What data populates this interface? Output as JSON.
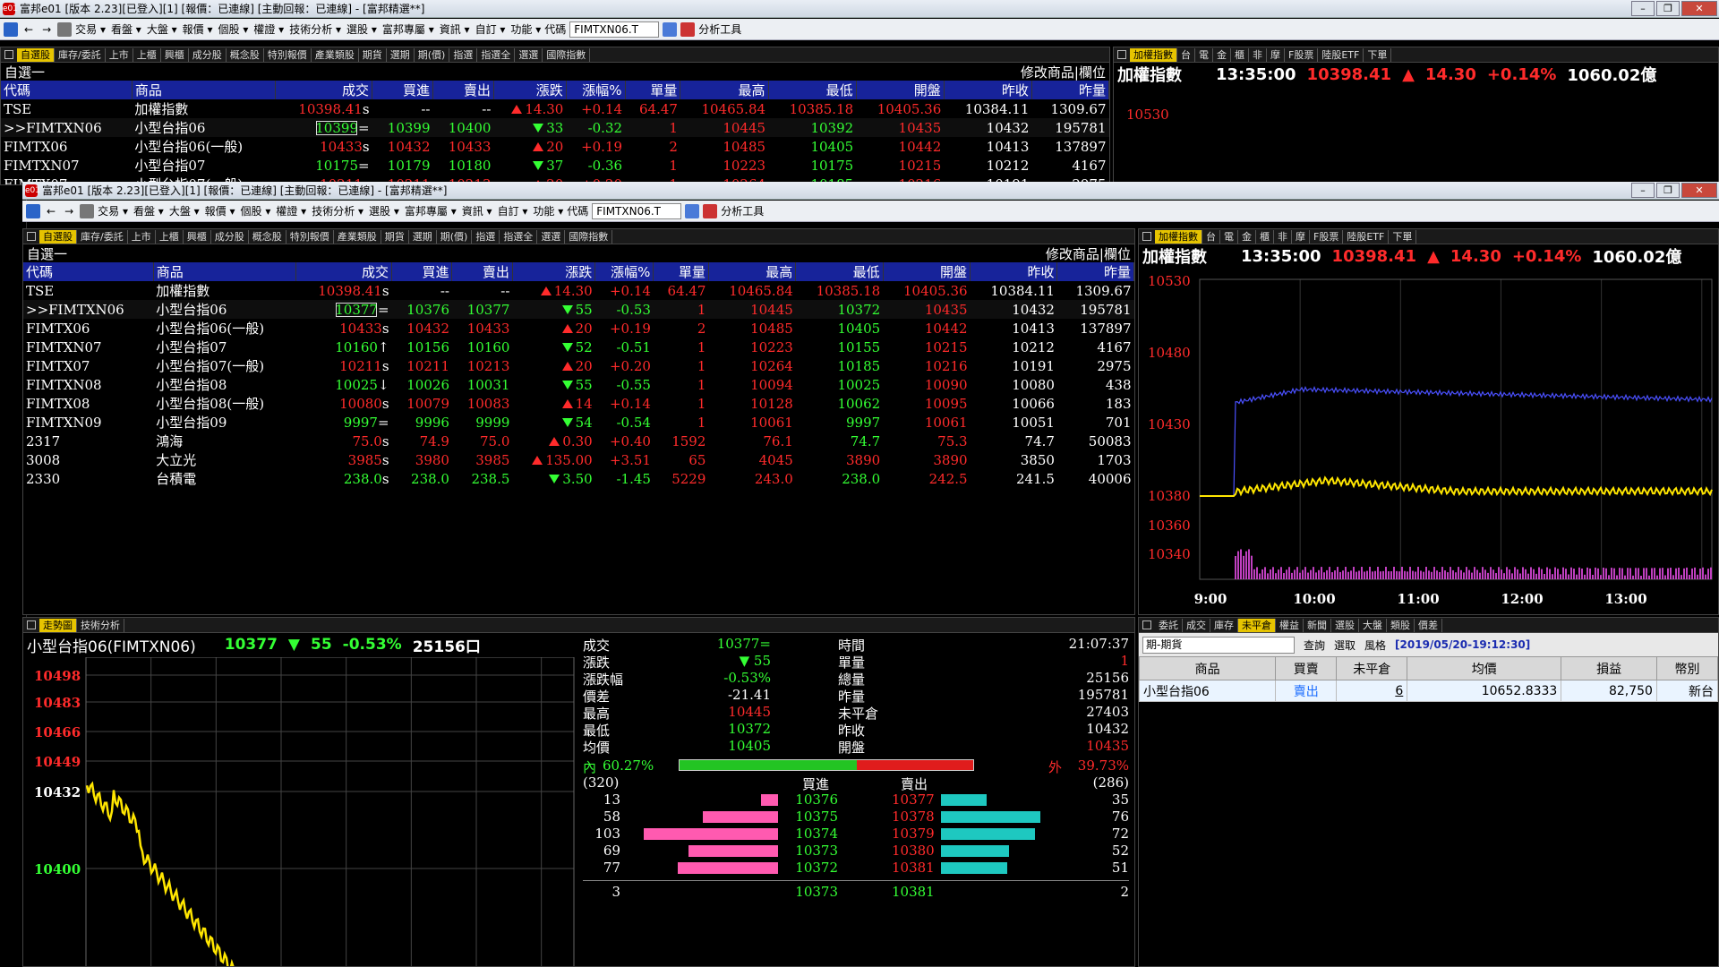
{
  "window": {
    "title_back": "富邦e01 [版本 2.23][已登入][1] [報價：已連線] [主動回報：已連線] - [富邦精選**]",
    "title_front": "富邦e01 [版本 2.23][已登入][1] [報價：已連線] [主動回報：已連線] - [富邦精選**]",
    "app_badge": "e01"
  },
  "toolbar": {
    "items": [
      "交易",
      "看盤",
      "大盤",
      "報價",
      "個股",
      "權證",
      "技術分析",
      "選股",
      "富邦專屬",
      "資訊",
      "自訂",
      "功能"
    ],
    "code_label": "代碼",
    "code_value_back": "FIMTXN06.T",
    "code_value_front": "FIMTXN06.T",
    "analysis_tools": "分析工具"
  },
  "quote_tabs": [
    "自選股",
    "庫存/委託",
    "上市",
    "上櫃",
    "興櫃",
    "成分股",
    "概念股",
    "特別報價",
    "產業類股",
    "期貨",
    "選期",
    "期(價)",
    "指選",
    "指選全",
    "選選",
    "國際指數"
  ],
  "quote_panel": {
    "list_name": "自選一",
    "modify": "修改商品",
    "columns_btn": "欄位",
    "headers": [
      "代碼",
      "商品",
      "成交",
      "買進",
      "賣出",
      "漲跌",
      "漲幅%",
      "單量",
      "最高",
      "最低",
      "開盤",
      "昨收",
      "昨量"
    ],
    "rows_back": [
      {
        "code": "TSE",
        "name": "加權指數",
        "last": "10398.41",
        "sfx": "s",
        "bid": "--",
        "ask": "--",
        "chg": "14.30",
        "dir": "up",
        "pct": "+0.14",
        "vol": "64.47",
        "high": "10465.84",
        "low": "10385.18",
        "open": "10405.36",
        "prev": "10384.11",
        "pvol": "1309.67"
      },
      {
        "code": ">>FIMTXN06",
        "name": "小型台指06",
        "last": "10399",
        "sfx": "=",
        "bid": "10399",
        "ask": "10400",
        "chg": "33",
        "dir": "down",
        "pct": "-0.32",
        "vol": "1",
        "high": "10445",
        "low": "10392",
        "open": "10435",
        "prev": "10432",
        "pvol": "195781"
      },
      {
        "code": "FIMTX06",
        "name": "小型台指06(一般)",
        "last": "10433",
        "sfx": "s",
        "bid": "10432",
        "ask": "10433",
        "chg": "20",
        "dir": "up",
        "pct": "+0.19",
        "vol": "2",
        "high": "10485",
        "low": "10405",
        "open": "10442",
        "prev": "10413",
        "pvol": "137897"
      },
      {
        "code": "FIMTXN07",
        "name": "小型台指07",
        "last": "10175",
        "sfx": "=",
        "bid": "10179",
        "ask": "10180",
        "chg": "37",
        "dir": "down",
        "pct": "-0.36",
        "vol": "1",
        "high": "10223",
        "low": "10175",
        "open": "10215",
        "prev": "10212",
        "pvol": "4167"
      },
      {
        "code": "FIMTX07",
        "name": "小型台指07(一般)",
        "last": "10211",
        "sfx": "s",
        "bid": "10211",
        "ask": "10213",
        "chg": "20",
        "dir": "up",
        "pct": "+0.20",
        "vol": "1",
        "high": "10264",
        "low": "10185",
        "open": "10216",
        "prev": "10191",
        "pvol": "2975"
      }
    ],
    "rows": [
      {
        "code": "TSE",
        "name": "加權指數",
        "last": "10398.41",
        "sfx": "s",
        "bid": "--",
        "ask": "--",
        "chg": "14.30",
        "dir": "up",
        "pct": "+0.14",
        "vol": "64.47",
        "high": "10465.84",
        "low": "10385.18",
        "open": "10405.36",
        "prev": "10384.11",
        "pvol": "1309.67"
      },
      {
        "code": ">>FIMTXN06",
        "name": "小型台指06",
        "last": "10377",
        "sfx": "=",
        "bid": "10376",
        "ask": "10377",
        "chg": "55",
        "dir": "down",
        "pct": "-0.53",
        "vol": "1",
        "high": "10445",
        "low": "10372",
        "open": "10435",
        "prev": "10432",
        "pvol": "195781"
      },
      {
        "code": "FIMTX06",
        "name": "小型台指06(一般)",
        "last": "10433",
        "sfx": "s",
        "bid": "10432",
        "ask": "10433",
        "chg": "20",
        "dir": "up",
        "pct": "+0.19",
        "vol": "2",
        "high": "10485",
        "low": "10405",
        "open": "10442",
        "prev": "10413",
        "pvol": "137897"
      },
      {
        "code": "FIMTXN07",
        "name": "小型台指07",
        "last": "10160",
        "sfx": "↑",
        "bid": "10156",
        "ask": "10160",
        "chg": "52",
        "dir": "down",
        "pct": "-0.51",
        "vol": "1",
        "high": "10223",
        "low": "10155",
        "open": "10215",
        "prev": "10212",
        "pvol": "4167"
      },
      {
        "code": "FIMTX07",
        "name": "小型台指07(一般)",
        "last": "10211",
        "sfx": "s",
        "bid": "10211",
        "ask": "10213",
        "chg": "20",
        "dir": "up",
        "pct": "+0.20",
        "vol": "1",
        "high": "10264",
        "low": "10185",
        "open": "10216",
        "prev": "10191",
        "pvol": "2975"
      },
      {
        "code": "FIMTXN08",
        "name": "小型台指08",
        "last": "10025",
        "sfx": "↓",
        "bid": "10026",
        "ask": "10031",
        "chg": "55",
        "dir": "down",
        "pct": "-0.55",
        "vol": "1",
        "high": "10094",
        "low": "10025",
        "open": "10090",
        "prev": "10080",
        "pvol": "438"
      },
      {
        "code": "FIMTX08",
        "name": "小型台指08(一般)",
        "last": "10080",
        "sfx": "s",
        "bid": "10079",
        "ask": "10083",
        "chg": "14",
        "dir": "up",
        "pct": "+0.14",
        "vol": "1",
        "high": "10128",
        "low": "10062",
        "open": "10095",
        "prev": "10066",
        "pvol": "183"
      },
      {
        "code": "FIMTXN09",
        "name": "小型台指09",
        "last": "9997",
        "sfx": "=",
        "bid": "9996",
        "ask": "9999",
        "chg": "54",
        "dir": "down",
        "pct": "-0.54",
        "vol": "1",
        "high": "10061",
        "low": "9997",
        "open": "10061",
        "prev": "10051",
        "pvol": "701"
      },
      {
        "code": "2317",
        "name": "鴻海",
        "last": "75.0",
        "sfx": "s",
        "bid": "74.9",
        "ask": "75.0",
        "chg": "0.30",
        "dir": "up",
        "pct": "+0.40",
        "vol": "1592",
        "high": "76.1",
        "low": "74.7",
        "open": "75.3",
        "prev": "74.7",
        "pvol": "50083"
      },
      {
        "code": "3008",
        "name": "大立光",
        "last": "3985",
        "sfx": "s",
        "bid": "3980",
        "ask": "3985",
        "chg": "135.00",
        "dir": "up",
        "pct": "+3.51",
        "vol": "65",
        "high": "4045",
        "low": "3890",
        "open": "3890",
        "prev": "3850",
        "pvol": "1703"
      },
      {
        "code": "2330",
        "name": "台積電",
        "last": "238.0",
        "sfx": "s",
        "bid": "238.0",
        "ask": "238.5",
        "chg": "3.50",
        "dir": "down",
        "pct": "-1.45",
        "vol": "5229",
        "high": "243.0",
        "low": "238.0",
        "open": "242.5",
        "prev": "241.5",
        "pvol": "40006"
      }
    ]
  },
  "index_tabs": [
    "加權指數",
    "台",
    "電",
    "金",
    "櫃",
    "非",
    "摩",
    "F股票",
    "陸股ETF",
    "下單"
  ],
  "index_panel": {
    "name": "加權指數",
    "time": "13:35:00",
    "value": "10398.41",
    "sfx": "s",
    "change": "14.30",
    "pct": "+0.14%",
    "volume": "1060.02億",
    "y_labels": [
      "10530",
      "10480",
      "10430",
      "10380",
      "10360",
      "10340"
    ],
    "x_labels": [
      "9:00",
      "10:00",
      "11:00",
      "12:00",
      "13:00"
    ]
  },
  "trend_tabs": [
    "走勢圖",
    "技術分析"
  ],
  "trend_panel": {
    "title": "小型台指06(FIMTXN06)",
    "last": "10377",
    "sfx": "=",
    "change": "55",
    "pct": "-0.53%",
    "volume": "25156口",
    "y_labels": [
      "10498",
      "10483",
      "10466",
      "10449",
      "10432",
      "10400"
    ]
  },
  "detail": {
    "left": [
      {
        "label": "成交",
        "value": "10377=",
        "color": "g"
      },
      {
        "label": "漲跌",
        "value": "▼ 55",
        "color": "g"
      },
      {
        "label": "漲跌幅",
        "value": "-0.53%",
        "color": "g"
      },
      {
        "label": "價差",
        "value": "-21.41",
        "color": "w"
      },
      {
        "label": "最高",
        "value": "10445",
        "color": "r"
      },
      {
        "label": "最低",
        "value": "10372",
        "color": "g"
      },
      {
        "label": "均價",
        "value": "10405",
        "color": "g"
      }
    ],
    "right": [
      {
        "label": "時間",
        "value": "21:07:37",
        "color": "w"
      },
      {
        "label": "單量",
        "value": "1",
        "color": "r"
      },
      {
        "label": "總量",
        "value": "25156",
        "color": "w"
      },
      {
        "label": "昨量",
        "value": "195781",
        "color": "w"
      },
      {
        "label": "未平倉",
        "value": "27403",
        "color": "w"
      },
      {
        "label": "昨收",
        "value": "10432",
        "color": "w"
      },
      {
        "label": "開盤",
        "value": "10435",
        "color": "r"
      }
    ],
    "inner_label": "內",
    "inner_pct": "60.27%",
    "outer_label": "外",
    "outer_pct": "39.73%",
    "inner_ratio": 0.6027,
    "bid_total": "(320)",
    "ask_total": "(286)",
    "bid_header": "買進",
    "ask_header": "賣出",
    "book": [
      {
        "bq": "13",
        "bp": "10376",
        "ap": "10377",
        "aq": "35"
      },
      {
        "bq": "58",
        "bp": "10375",
        "ap": "10378",
        "aq": "76"
      },
      {
        "bq": "103",
        "bp": "10374",
        "ap": "10379",
        "aq": "72"
      },
      {
        "bq": "69",
        "bp": "10373",
        "ap": "10380",
        "aq": "52"
      },
      {
        "bq": "77",
        "bp": "10372",
        "ap": "10381",
        "aq": "51"
      }
    ],
    "foot": {
      "left": "3",
      "bp": "10373",
      "ap": "10381",
      "right": "2"
    }
  },
  "order_tabs": [
    "委託",
    "成交",
    "庫存",
    "未平倉",
    "權益",
    "新聞",
    "選股",
    "大盤",
    "類股",
    "價差"
  ],
  "order_panel": {
    "account": "期-期貨",
    "query": "查詢",
    "select": "選取",
    "style": "風格",
    "timestamp": "[2019/05/20-19:12:30]",
    "headers": [
      "商品",
      "買賣",
      "未平倉",
      "均價",
      "損益",
      "幣別"
    ],
    "row": {
      "product": "小型台指06",
      "side": "賣出",
      "qty": "6",
      "avg": "10652.8333",
      "pnl": "82,750",
      "ccy": "新台"
    }
  },
  "colors": {
    "accent_tab": "#e6c400",
    "header_blue": "#17239a",
    "up": "#ff2b2b",
    "down": "#34ff34",
    "line_yellow": "#ffe600",
    "line_blue": "#4a50ff"
  }
}
